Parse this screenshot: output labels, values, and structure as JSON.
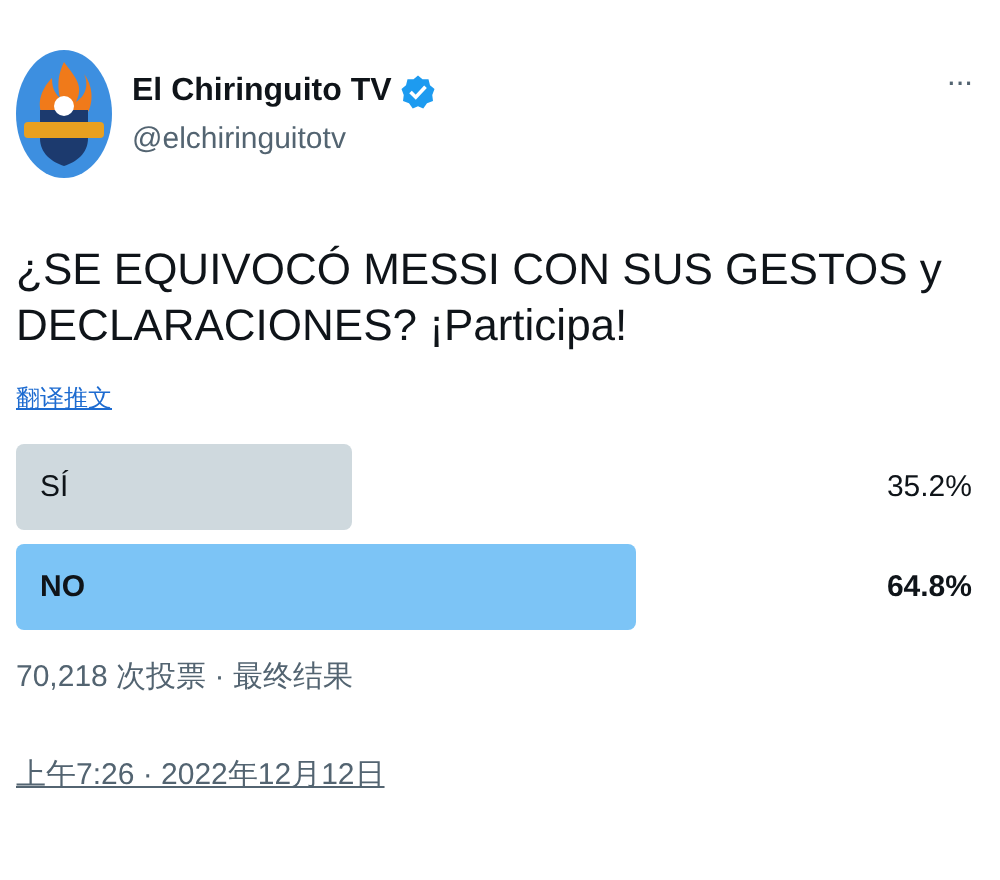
{
  "author": {
    "name": "El Chiringuito TV",
    "verified": true,
    "handle": "@elchiringuitotv"
  },
  "menu": "···",
  "tweet_text": "¿SE EQUIVOCÓ MESSI CON SUS GESTOS y DECLARACIONES? ¡Participa!",
  "translate_link": "翻译推文",
  "poll": {
    "options": [
      {
        "label": "SÍ",
        "percent": "35.2%",
        "level": 0.352,
        "winner": false
      },
      {
        "label": "NO",
        "percent": "64.8%",
        "level": 0.648,
        "winner": true
      }
    ],
    "summary": "70,218 次投票 · 最终结果"
  },
  "timestamp": "上午7:26 · 2022年12月12日"
}
